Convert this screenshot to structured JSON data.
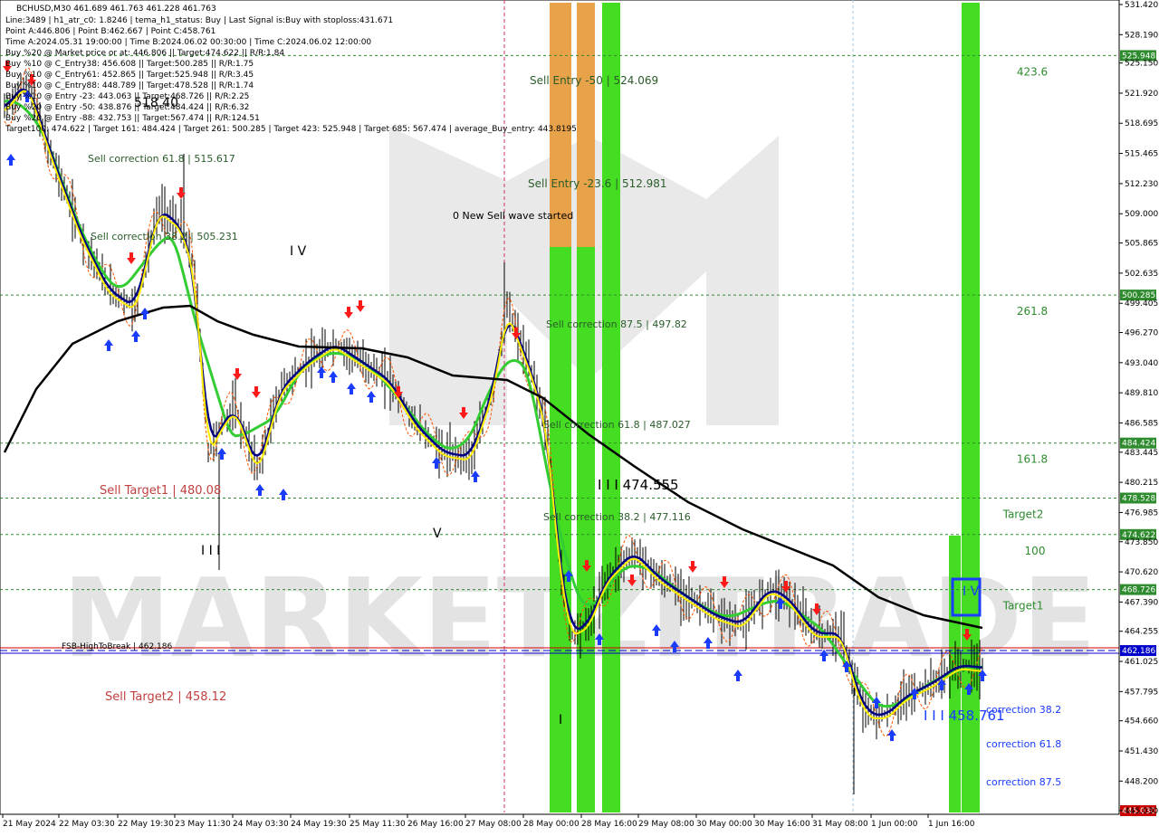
{
  "chart_data": {
    "type": "candlestick",
    "symbol_line": "BCHUSD,M30  461.689 461.763 461.228 461.763",
    "info_lines": [
      "Line:3489 | h1_atr_c0: 1.8246 | tema_h1_status: Buy | Last Signal is:Buy with stoploss:431.671",
      "Point A:446.806 | Point B:462.667 | Point C:458.761",
      "Time A:2024.05.31 19:00:00 | Time B:2024.06.02 00:30:00 | Time C:2024.06.02 12:00:00",
      "Buy %20 @ Market price or at: 446.806 || Target:474.622 || R/R:1.84",
      "Buy %10 @ C_Entry38: 456.608 || Target:500.285 || R/R:1.75",
      "Buy %10 @ C_Entry61: 452.865 || Target:525.948 || R/R:3.45",
      "Buy %10 @ C_Entry88: 448.789 || Target:478.528 || R/R:1.74",
      "Buy %10 @ Entry -23: 443.063 || Target:468.726 || R/R:2.25",
      "Buy %20 @ Entry -50: 438.876 || Target:484.424 || R/R:6.32",
      "Buy %20 @ Entry -88: 432.753 || Target:567.474 || R/R:124.51",
      "Target100: 474.622 | Target 161: 484.424 | Target 261: 500.285 | Target 423: 525.948 | Target 685: 567.474 | average_Buy_entry: 443.8195"
    ],
    "y_ticks": [
      "531.420",
      "528.190",
      "525.150",
      "521.920",
      "518.695",
      "515.465",
      "512.230",
      "509.000",
      "505.865",
      "502.635",
      "499.405",
      "496.270",
      "493.040",
      "489.810",
      "486.585",
      "483.445",
      "480.215",
      "476.985",
      "473.850",
      "470.620",
      "467.390",
      "464.255",
      "461.025",
      "457.795",
      "454.660",
      "451.430",
      "448.200",
      "445.030"
    ],
    "ylim": [
      445.03,
      531.42
    ],
    "x_labels": [
      "21 May 2024",
      "22 May 03:30",
      "22 May 19:30",
      "23 May 11:30",
      "24 May 03:30",
      "24 May 19:30",
      "25 May 11:30",
      "26 May 16:00",
      "27 May 08:00",
      "28 May 00:00",
      "28 May 16:00",
      "29 May 08:00",
      "30 May 00:00",
      "30 May 16:00",
      "31 May 08:00",
      "1 Jun 00:00",
      "1 Jun 16:00"
    ],
    "levels": [
      {
        "value": 525.948,
        "price_label": "525.948",
        "right_label": "423.6",
        "color": "#2e8b2e"
      },
      {
        "value": 500.285,
        "price_label": "500.285",
        "right_label": "261.8",
        "color": "#2e8b2e"
      },
      {
        "value": 484.424,
        "price_label": "484.424",
        "right_label": "161.8",
        "color": "#2e8b2e"
      },
      {
        "value": 478.528,
        "price_label": "478.528",
        "right_label": "Target2",
        "color": "#2e8b2e"
      },
      {
        "value": 474.622,
        "price_label": "474.622",
        "right_label": "100",
        "color": "#2e8b2e"
      },
      {
        "value": 468.726,
        "price_label": "468.726",
        "right_label": "Target1",
        "color": "#2e8b2e"
      },
      {
        "value": 462.186,
        "price_label": "462.186",
        "right_label": "",
        "color": "#0000cc"
      }
    ],
    "current_price": "445.030",
    "annotations": {
      "sell_entry_50": "Sell Entry -50 | 524.069",
      "sell_entry_23": "Sell Entry -23.6 | 512.981",
      "new_sell_wave": "0 New Sell wave started",
      "sell_corr_875": "Sell correction 87.5 | 497.82",
      "sell_corr_618": "Sell correction 61.8 | 487.027",
      "sell_corr_382": "Sell correction 38.2 | 477.116",
      "sell_corr_618_left": "Sell correction 61.8 | 515.617",
      "sell_corr_382_left": "Sell correction 38.2 | 505.231",
      "wave_iv_left": "I V",
      "wave_v": "V",
      "wave_iii_left": "I I I",
      "wave_iii_mid": "I I I 474.555",
      "wave_i": "I",
      "wave_iv_right": "I V",
      "wave_iii_right": "I I I 458.761",
      "top_left_label": "518.40",
      "sell_target1": "Sell Target1 | 480.08",
      "sell_target2": "Sell Target2 | 458.12",
      "fsb": "FSB-HighToBreak | 462.186",
      "corr_382": "correction 38.2",
      "corr_618": "correction 61.8",
      "corr_875": "correction 87.5"
    },
    "watermark": "MARKETZITRADE",
    "colors": {
      "up_candle": "#000000",
      "ema_fast": "#000080",
      "ema_mid": "#33cc33",
      "ema_slow": "#000000",
      "signal_line": "#ffff00",
      "buy_arrow": "#1a3cff",
      "sell_arrow": "#ff1a1a",
      "zone_green": "#44dd22",
      "zone_orange": "#e8a24a"
    }
  }
}
